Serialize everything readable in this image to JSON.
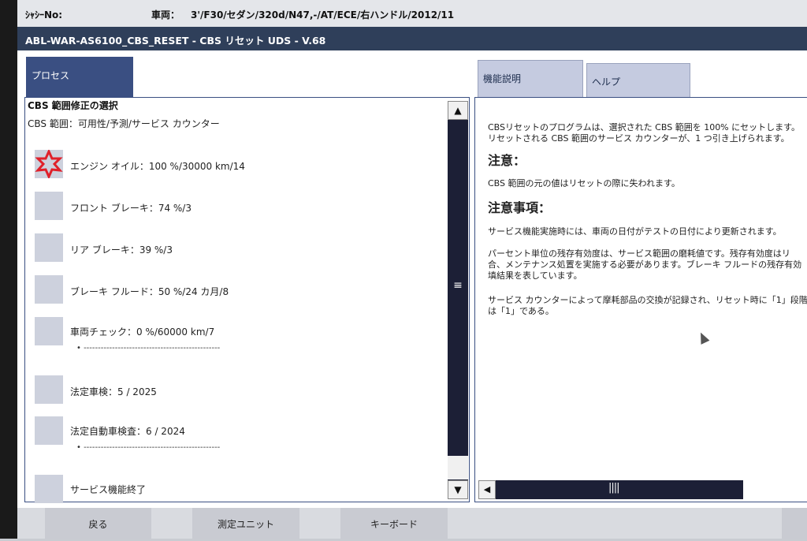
{
  "header": {
    "chassis_label": "ｼｬｼｰNo:",
    "chassis_value": "",
    "vehicle_label": "車両：",
    "vehicle_value": "3'/F30/セダン/320d/N47,-/AT/ECE/右ハンドル/2012/11"
  },
  "window_title": "ABL-WAR-AS6100_CBS_RESET - CBS リセット UDS - V.68",
  "tabs": {
    "process": "プロセス",
    "function_desc": "機能説明",
    "help": "ヘルプ"
  },
  "left": {
    "title": "CBS 範囲修正の選択",
    "subtitle": "CBS 範囲：可用性/予測/サービス カウンター",
    "items": [
      {
        "label": "エンジン オイル：100 %/30000 km/14",
        "selected": true
      },
      {
        "label": "フロント ブレーキ：74 %/3",
        "selected": false
      },
      {
        "label": "リア ブレーキ：39 %/3",
        "selected": false
      },
      {
        "label": "ブレーキ フルード：50 %/24 カ月/8",
        "selected": false
      },
      {
        "label": "車両チェック：0 %/60000 km/7",
        "selected": false
      },
      {
        "label": "法定車検：5 / 2025",
        "selected": false
      },
      {
        "label": "法定自動車検査：6 / 2024",
        "selected": false
      },
      {
        "label": "サービス機能終了",
        "selected": false
      }
    ],
    "dash_line": "• ------------------------------------------------"
  },
  "right": {
    "p1_line1": "CBSリセットのプログラムは、選択された CBS 範囲を 100% にセットします。",
    "p1_line2": "リセットされる CBS 範囲のサービス カウンターが、1 つ引き上げられます。",
    "h_caution": "注意：",
    "caution_text": "CBS 範囲の元の値はリセットの際に失われます。",
    "h_notes": "注意事項：",
    "notes_text": "サービス機能実施時には、車両の日付がテストの日付により更新されます。",
    "p3_line1": "パーセント単位の残存有効度は、サービス範囲の磨耗値です。残存有効度はリ",
    "p3_line2": "合、メンテナンス処置を実施する必要があります。ブレーキ フルードの残存有効",
    "p3_line3": "填結果を表しています。",
    "p4_line1": "サービス カウンターによって摩耗部品の交換が記録され、リセット時に「1」段階",
    "p4_line2": "は「1」である。"
  },
  "bottom": {
    "back": "戻る",
    "measure": "測定ユニット",
    "keyboard": "キーボード"
  },
  "colors": {
    "title_bar": "#2f3f5a",
    "active_tab": "#3a4f82",
    "inactive_tab": "#c5cbe0",
    "scrollbar": "#1c1f36",
    "selected_star": "#e0202a"
  }
}
